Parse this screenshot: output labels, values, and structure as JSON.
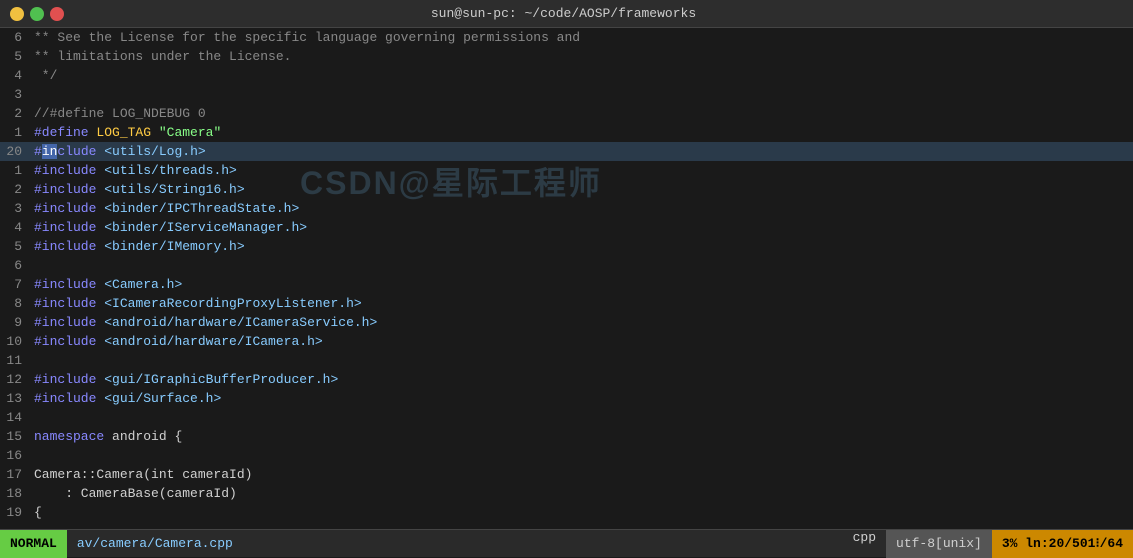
{
  "titlebar": {
    "title": "sun@sun-pc: ~/code/AOSP/frameworks"
  },
  "window_controls": {
    "minimize": "─",
    "maximize": "□",
    "close": "×"
  },
  "lines": [
    {
      "num": "6",
      "content": "** See the License for the specific language governing permissions and",
      "highlight": false,
      "type": "comment"
    },
    {
      "num": "5",
      "content": "** limitations under the License.",
      "highlight": false,
      "type": "comment"
    },
    {
      "num": "4",
      "content": " */",
      "highlight": false,
      "type": "comment"
    },
    {
      "num": "3",
      "content": "",
      "highlight": false,
      "type": "normal"
    },
    {
      "num": "2",
      "content": "//#define LOG_NDEBUG 0",
      "highlight": false,
      "type": "comment"
    },
    {
      "num": "1",
      "content": "#define LOG_TAG \"Camera\"",
      "highlight": false,
      "type": "define"
    },
    {
      "num": "20",
      "content": "#include <utils/Log.h>",
      "highlight": true,
      "type": "include"
    },
    {
      "num": "1",
      "content": "#include <utils/threads.h>",
      "highlight": false,
      "type": "include"
    },
    {
      "num": "2",
      "content": "#include <utils/String16.h>",
      "highlight": false,
      "type": "include"
    },
    {
      "num": "3",
      "content": "#include <binder/IPCThreadState.h>",
      "highlight": false,
      "type": "include"
    },
    {
      "num": "4",
      "content": "#include <binder/IServiceManager.h>",
      "highlight": false,
      "type": "include"
    },
    {
      "num": "5",
      "content": "#include <binder/IMemory.h>",
      "highlight": false,
      "type": "include"
    },
    {
      "num": "6",
      "content": "",
      "highlight": false,
      "type": "normal"
    },
    {
      "num": "7",
      "content": "#include <Camera.h>",
      "highlight": false,
      "type": "include"
    },
    {
      "num": "8",
      "content": "#include <ICameraRecordingProxyListener.h>",
      "highlight": false,
      "type": "include"
    },
    {
      "num": "9",
      "content": "#include <android/hardware/ICameraService.h>",
      "highlight": false,
      "type": "include"
    },
    {
      "num": "10",
      "content": "#include <android/hardware/ICamera.h>",
      "highlight": false,
      "type": "include"
    },
    {
      "num": "11",
      "content": "",
      "highlight": false,
      "type": "normal"
    },
    {
      "num": "12",
      "content": "#include <gui/IGraphicBufferProducer.h>",
      "highlight": false,
      "type": "include"
    },
    {
      "num": "13",
      "content": "#include <gui/Surface.h>",
      "highlight": false,
      "type": "include"
    },
    {
      "num": "14",
      "content": "",
      "highlight": false,
      "type": "normal"
    },
    {
      "num": "15",
      "content": "namespace android {",
      "highlight": false,
      "type": "namespace"
    },
    {
      "num": "16",
      "content": "",
      "highlight": false,
      "type": "normal"
    },
    {
      "num": "17",
      "content": "Camera::Camera(int cameraId)",
      "highlight": false,
      "type": "normal"
    },
    {
      "num": "18",
      "content": "    : CameraBase(cameraId)",
      "highlight": false,
      "type": "normal"
    },
    {
      "num": "19",
      "content": "{",
      "highlight": false,
      "type": "normal"
    }
  ],
  "watermark": "CSDN@星际工程师",
  "statusbar": {
    "mode": "NORMAL",
    "file": "av/camera/Camera.cpp",
    "filetype": "cpp",
    "encoding": "utf-8[unix]",
    "position": "3% ln:20/501⁝/64"
  }
}
